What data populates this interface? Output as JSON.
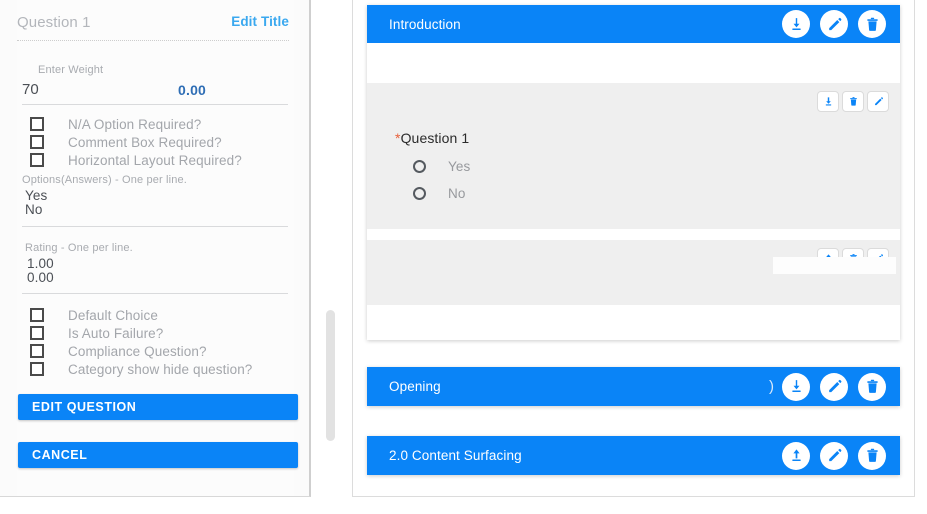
{
  "editor": {
    "title": "Question 1",
    "edit_title_link": "Edit Title",
    "weight_label": "Enter Weight",
    "weight_value": "70",
    "weight_calculated": "0.00",
    "option_checkboxes": [
      {
        "label": "N/A Option Required?",
        "checked": false
      },
      {
        "label": "Comment Box Required?",
        "checked": false
      },
      {
        "label": "Horizontal Layout Required?",
        "checked": false
      }
    ],
    "options_label": "Options(Answers) - One per line.",
    "options_lines": [
      "Yes",
      "No"
    ],
    "rating_label": "Rating - One per line.",
    "rating_lines": [
      "1.00",
      "0.00"
    ],
    "behavior_checkboxes": [
      {
        "label": "Default Choice",
        "checked": false
      },
      {
        "label": "Is Auto Failure?",
        "checked": false
      },
      {
        "label": "Compliance Question?",
        "checked": false
      },
      {
        "label": "Category show hide question?",
        "checked": false
      }
    ],
    "primary_button": "EDIT QUESTION",
    "secondary_button": "CANCEL"
  },
  "preview": {
    "sections": [
      {
        "title": "Introduction",
        "actions": [
          "download-icon",
          "edit-icon",
          "delete-icon"
        ],
        "stray_char": ""
      },
      {
        "title": "Opening",
        "actions": [
          "download-icon",
          "edit-icon",
          "delete-icon"
        ],
        "stray_char": ")"
      },
      {
        "title": "2.0 Content Surfacing",
        "actions": [
          "upload-icon",
          "edit-icon",
          "delete-icon"
        ],
        "stray_char": ""
      }
    ],
    "row_toolbars": [
      {
        "actions": [
          "download-icon",
          "delete-icon",
          "edit-icon"
        ]
      },
      {
        "actions": [
          "upload-icon",
          "delete-icon",
          "edit-icon"
        ]
      }
    ],
    "question": {
      "required_marker": "*",
      "text": "Question 1",
      "options": [
        {
          "label": "Yes",
          "selected": false
        },
        {
          "label": "No",
          "selected": false
        }
      ]
    }
  },
  "colors": {
    "accent_blue": "#0a84f7",
    "link_blue": "#3aa8ef",
    "calc_blue": "#2f6eb5",
    "required_red": "#e8603c",
    "band_gray": "#efefef",
    "muted_text": "#a3a6ab"
  }
}
